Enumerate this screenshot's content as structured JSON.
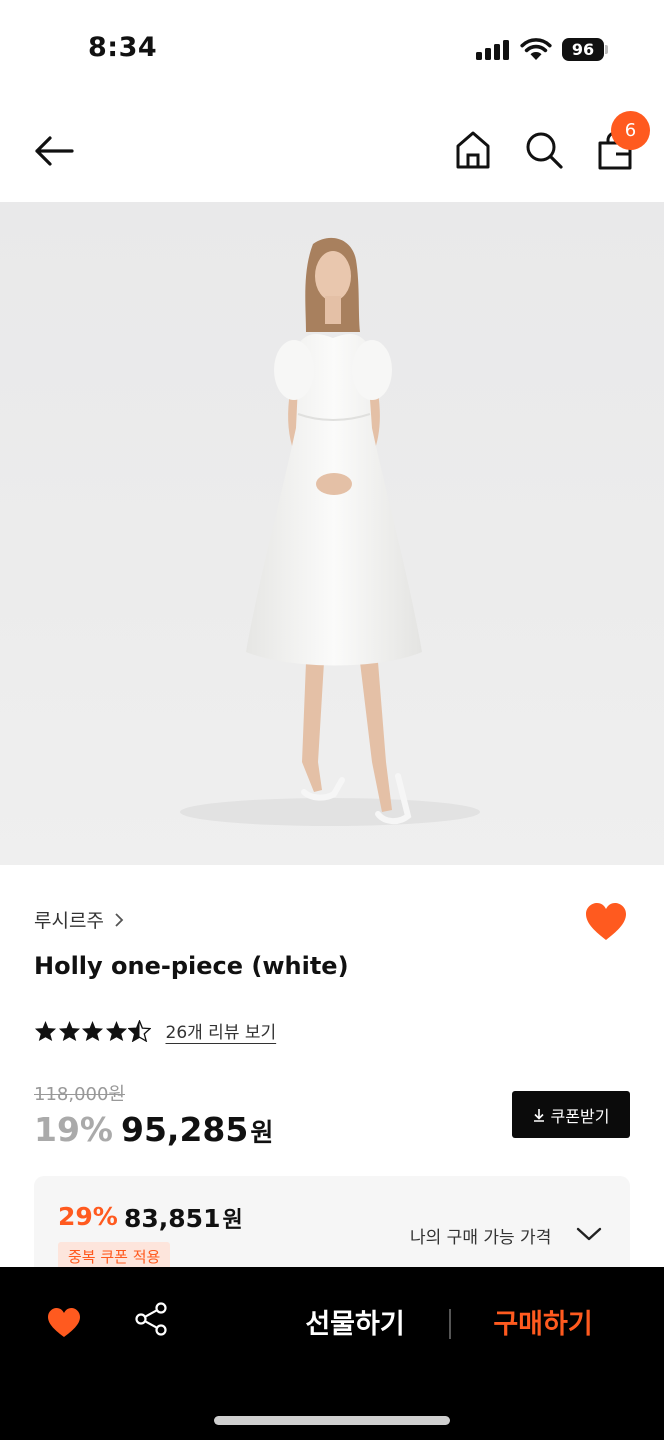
{
  "status_bar": {
    "time": "8:34",
    "battery": "96"
  },
  "nav": {
    "back_icon": "arrow-left-icon",
    "home_icon": "home-icon",
    "search_icon": "search-icon",
    "bag_icon": "shopping-bag-icon",
    "bag_count": "6"
  },
  "product": {
    "image": "model-white-dress-photo",
    "brand": "루시르주",
    "name": "Holly one-piece (white)",
    "rating": 4.5,
    "review_link": "26개 리뷰 보기",
    "original_price": "118,000원",
    "discount_rate": "19%",
    "sale_price": "95,285",
    "currency": "원",
    "wishlisted": true
  },
  "coupon": {
    "label": "쿠폰받기"
  },
  "best_price": {
    "rate": "29%",
    "price": "83,851",
    "currency": "원",
    "badge": "중복 쿠폰 적용",
    "my_price_label": "나의 구매 가능 가격"
  },
  "bottom_bar": {
    "gift_label": "선물하기",
    "buy_label": "구매하기"
  },
  "colors": {
    "accent": "#ff5a1f",
    "black": "#0b0b0b",
    "muted": "#999999"
  }
}
